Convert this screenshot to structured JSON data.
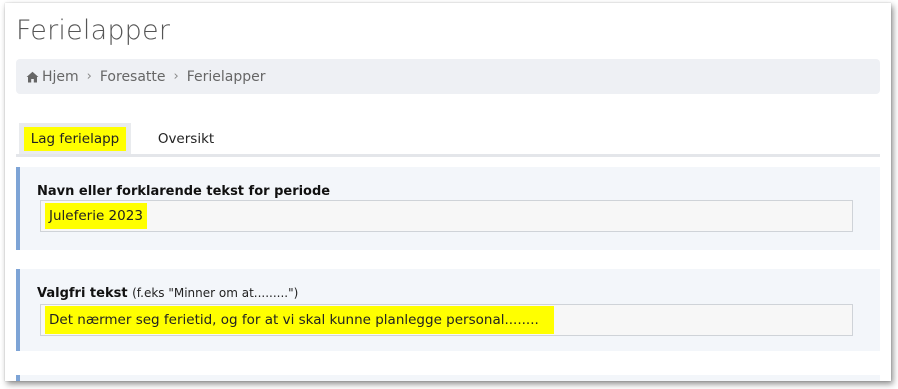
{
  "page": {
    "title": "Ferielapper"
  },
  "breadcrumb": {
    "items": [
      "Hjem",
      "Foresatte",
      "Ferielapper"
    ],
    "separator": "›"
  },
  "tabs": [
    {
      "label": "Lag ferielapp",
      "active": true
    },
    {
      "label": "Oversikt",
      "active": false
    }
  ],
  "form": {
    "period_name": {
      "label": "Navn eller forklarende tekst for periode",
      "value": "Juleferie 2023"
    },
    "optional_text": {
      "label": "Valgfri tekst",
      "hint": "(f.eks \"Minner om at.........\")",
      "value": "Det nærmer seg ferietid, og for at vi skal kunne planlegge personal........"
    }
  },
  "colors": {
    "highlight": "#ffff00",
    "card_accent": "#7ea4d6",
    "card_background": "#f3f6fa",
    "breadcrumb_background": "#eef0f4"
  }
}
